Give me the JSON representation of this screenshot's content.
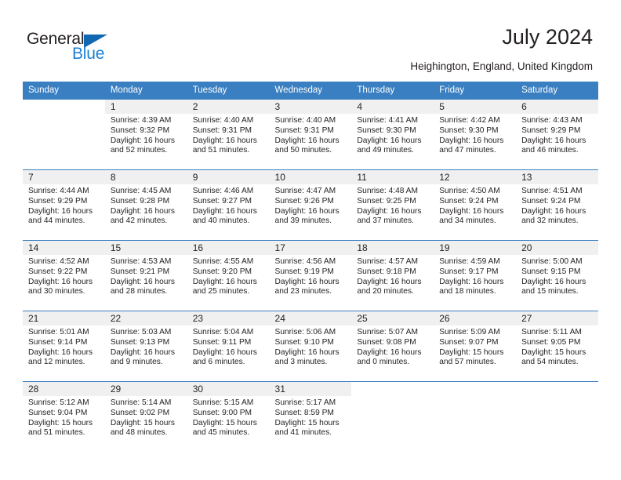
{
  "brand": {
    "name_part1": "General",
    "name_part2": "Blue",
    "accent_color": "#1c7fd4",
    "triangle_color": "#1267b2"
  },
  "header": {
    "title": "July 2024",
    "subtitle": "Heighington, England, United Kingdom"
  },
  "calendar": {
    "header_bg": "#3a7fc1",
    "daynum_bg": "#f0f0f0",
    "weekdays": [
      "Sunday",
      "Monday",
      "Tuesday",
      "Wednesday",
      "Thursday",
      "Friday",
      "Saturday"
    ],
    "weeks": [
      [
        {
          "day": ""
        },
        {
          "day": "1",
          "sunrise": "Sunrise: 4:39 AM",
          "sunset": "Sunset: 9:32 PM",
          "daylight1": "Daylight: 16 hours",
          "daylight2": "and 52 minutes."
        },
        {
          "day": "2",
          "sunrise": "Sunrise: 4:40 AM",
          "sunset": "Sunset: 9:31 PM",
          "daylight1": "Daylight: 16 hours",
          "daylight2": "and 51 minutes."
        },
        {
          "day": "3",
          "sunrise": "Sunrise: 4:40 AM",
          "sunset": "Sunset: 9:31 PM",
          "daylight1": "Daylight: 16 hours",
          "daylight2": "and 50 minutes."
        },
        {
          "day": "4",
          "sunrise": "Sunrise: 4:41 AM",
          "sunset": "Sunset: 9:30 PM",
          "daylight1": "Daylight: 16 hours",
          "daylight2": "and 49 minutes."
        },
        {
          "day": "5",
          "sunrise": "Sunrise: 4:42 AM",
          "sunset": "Sunset: 9:30 PM",
          "daylight1": "Daylight: 16 hours",
          "daylight2": "and 47 minutes."
        },
        {
          "day": "6",
          "sunrise": "Sunrise: 4:43 AM",
          "sunset": "Sunset: 9:29 PM",
          "daylight1": "Daylight: 16 hours",
          "daylight2": "and 46 minutes."
        }
      ],
      [
        {
          "day": "7",
          "sunrise": "Sunrise: 4:44 AM",
          "sunset": "Sunset: 9:29 PM",
          "daylight1": "Daylight: 16 hours",
          "daylight2": "and 44 minutes."
        },
        {
          "day": "8",
          "sunrise": "Sunrise: 4:45 AM",
          "sunset": "Sunset: 9:28 PM",
          "daylight1": "Daylight: 16 hours",
          "daylight2": "and 42 minutes."
        },
        {
          "day": "9",
          "sunrise": "Sunrise: 4:46 AM",
          "sunset": "Sunset: 9:27 PM",
          "daylight1": "Daylight: 16 hours",
          "daylight2": "and 40 minutes."
        },
        {
          "day": "10",
          "sunrise": "Sunrise: 4:47 AM",
          "sunset": "Sunset: 9:26 PM",
          "daylight1": "Daylight: 16 hours",
          "daylight2": "and 39 minutes."
        },
        {
          "day": "11",
          "sunrise": "Sunrise: 4:48 AM",
          "sunset": "Sunset: 9:25 PM",
          "daylight1": "Daylight: 16 hours",
          "daylight2": "and 37 minutes."
        },
        {
          "day": "12",
          "sunrise": "Sunrise: 4:50 AM",
          "sunset": "Sunset: 9:24 PM",
          "daylight1": "Daylight: 16 hours",
          "daylight2": "and 34 minutes."
        },
        {
          "day": "13",
          "sunrise": "Sunrise: 4:51 AM",
          "sunset": "Sunset: 9:24 PM",
          "daylight1": "Daylight: 16 hours",
          "daylight2": "and 32 minutes."
        }
      ],
      [
        {
          "day": "14",
          "sunrise": "Sunrise: 4:52 AM",
          "sunset": "Sunset: 9:22 PM",
          "daylight1": "Daylight: 16 hours",
          "daylight2": "and 30 minutes."
        },
        {
          "day": "15",
          "sunrise": "Sunrise: 4:53 AM",
          "sunset": "Sunset: 9:21 PM",
          "daylight1": "Daylight: 16 hours",
          "daylight2": "and 28 minutes."
        },
        {
          "day": "16",
          "sunrise": "Sunrise: 4:55 AM",
          "sunset": "Sunset: 9:20 PM",
          "daylight1": "Daylight: 16 hours",
          "daylight2": "and 25 minutes."
        },
        {
          "day": "17",
          "sunrise": "Sunrise: 4:56 AM",
          "sunset": "Sunset: 9:19 PM",
          "daylight1": "Daylight: 16 hours",
          "daylight2": "and 23 minutes."
        },
        {
          "day": "18",
          "sunrise": "Sunrise: 4:57 AM",
          "sunset": "Sunset: 9:18 PM",
          "daylight1": "Daylight: 16 hours",
          "daylight2": "and 20 minutes."
        },
        {
          "day": "19",
          "sunrise": "Sunrise: 4:59 AM",
          "sunset": "Sunset: 9:17 PM",
          "daylight1": "Daylight: 16 hours",
          "daylight2": "and 18 minutes."
        },
        {
          "day": "20",
          "sunrise": "Sunrise: 5:00 AM",
          "sunset": "Sunset: 9:15 PM",
          "daylight1": "Daylight: 16 hours",
          "daylight2": "and 15 minutes."
        }
      ],
      [
        {
          "day": "21",
          "sunrise": "Sunrise: 5:01 AM",
          "sunset": "Sunset: 9:14 PM",
          "daylight1": "Daylight: 16 hours",
          "daylight2": "and 12 minutes."
        },
        {
          "day": "22",
          "sunrise": "Sunrise: 5:03 AM",
          "sunset": "Sunset: 9:13 PM",
          "daylight1": "Daylight: 16 hours",
          "daylight2": "and 9 minutes."
        },
        {
          "day": "23",
          "sunrise": "Sunrise: 5:04 AM",
          "sunset": "Sunset: 9:11 PM",
          "daylight1": "Daylight: 16 hours",
          "daylight2": "and 6 minutes."
        },
        {
          "day": "24",
          "sunrise": "Sunrise: 5:06 AM",
          "sunset": "Sunset: 9:10 PM",
          "daylight1": "Daylight: 16 hours",
          "daylight2": "and 3 minutes."
        },
        {
          "day": "25",
          "sunrise": "Sunrise: 5:07 AM",
          "sunset": "Sunset: 9:08 PM",
          "daylight1": "Daylight: 16 hours",
          "daylight2": "and 0 minutes."
        },
        {
          "day": "26",
          "sunrise": "Sunrise: 5:09 AM",
          "sunset": "Sunset: 9:07 PM",
          "daylight1": "Daylight: 15 hours",
          "daylight2": "and 57 minutes."
        },
        {
          "day": "27",
          "sunrise": "Sunrise: 5:11 AM",
          "sunset": "Sunset: 9:05 PM",
          "daylight1": "Daylight: 15 hours",
          "daylight2": "and 54 minutes."
        }
      ],
      [
        {
          "day": "28",
          "sunrise": "Sunrise: 5:12 AM",
          "sunset": "Sunset: 9:04 PM",
          "daylight1": "Daylight: 15 hours",
          "daylight2": "and 51 minutes."
        },
        {
          "day": "29",
          "sunrise": "Sunrise: 5:14 AM",
          "sunset": "Sunset: 9:02 PM",
          "daylight1": "Daylight: 15 hours",
          "daylight2": "and 48 minutes."
        },
        {
          "day": "30",
          "sunrise": "Sunrise: 5:15 AM",
          "sunset": "Sunset: 9:00 PM",
          "daylight1": "Daylight: 15 hours",
          "daylight2": "and 45 minutes."
        },
        {
          "day": "31",
          "sunrise": "Sunrise: 5:17 AM",
          "sunset": "Sunset: 8:59 PM",
          "daylight1": "Daylight: 15 hours",
          "daylight2": "and 41 minutes."
        },
        {
          "day": ""
        },
        {
          "day": ""
        },
        {
          "day": ""
        }
      ]
    ]
  }
}
